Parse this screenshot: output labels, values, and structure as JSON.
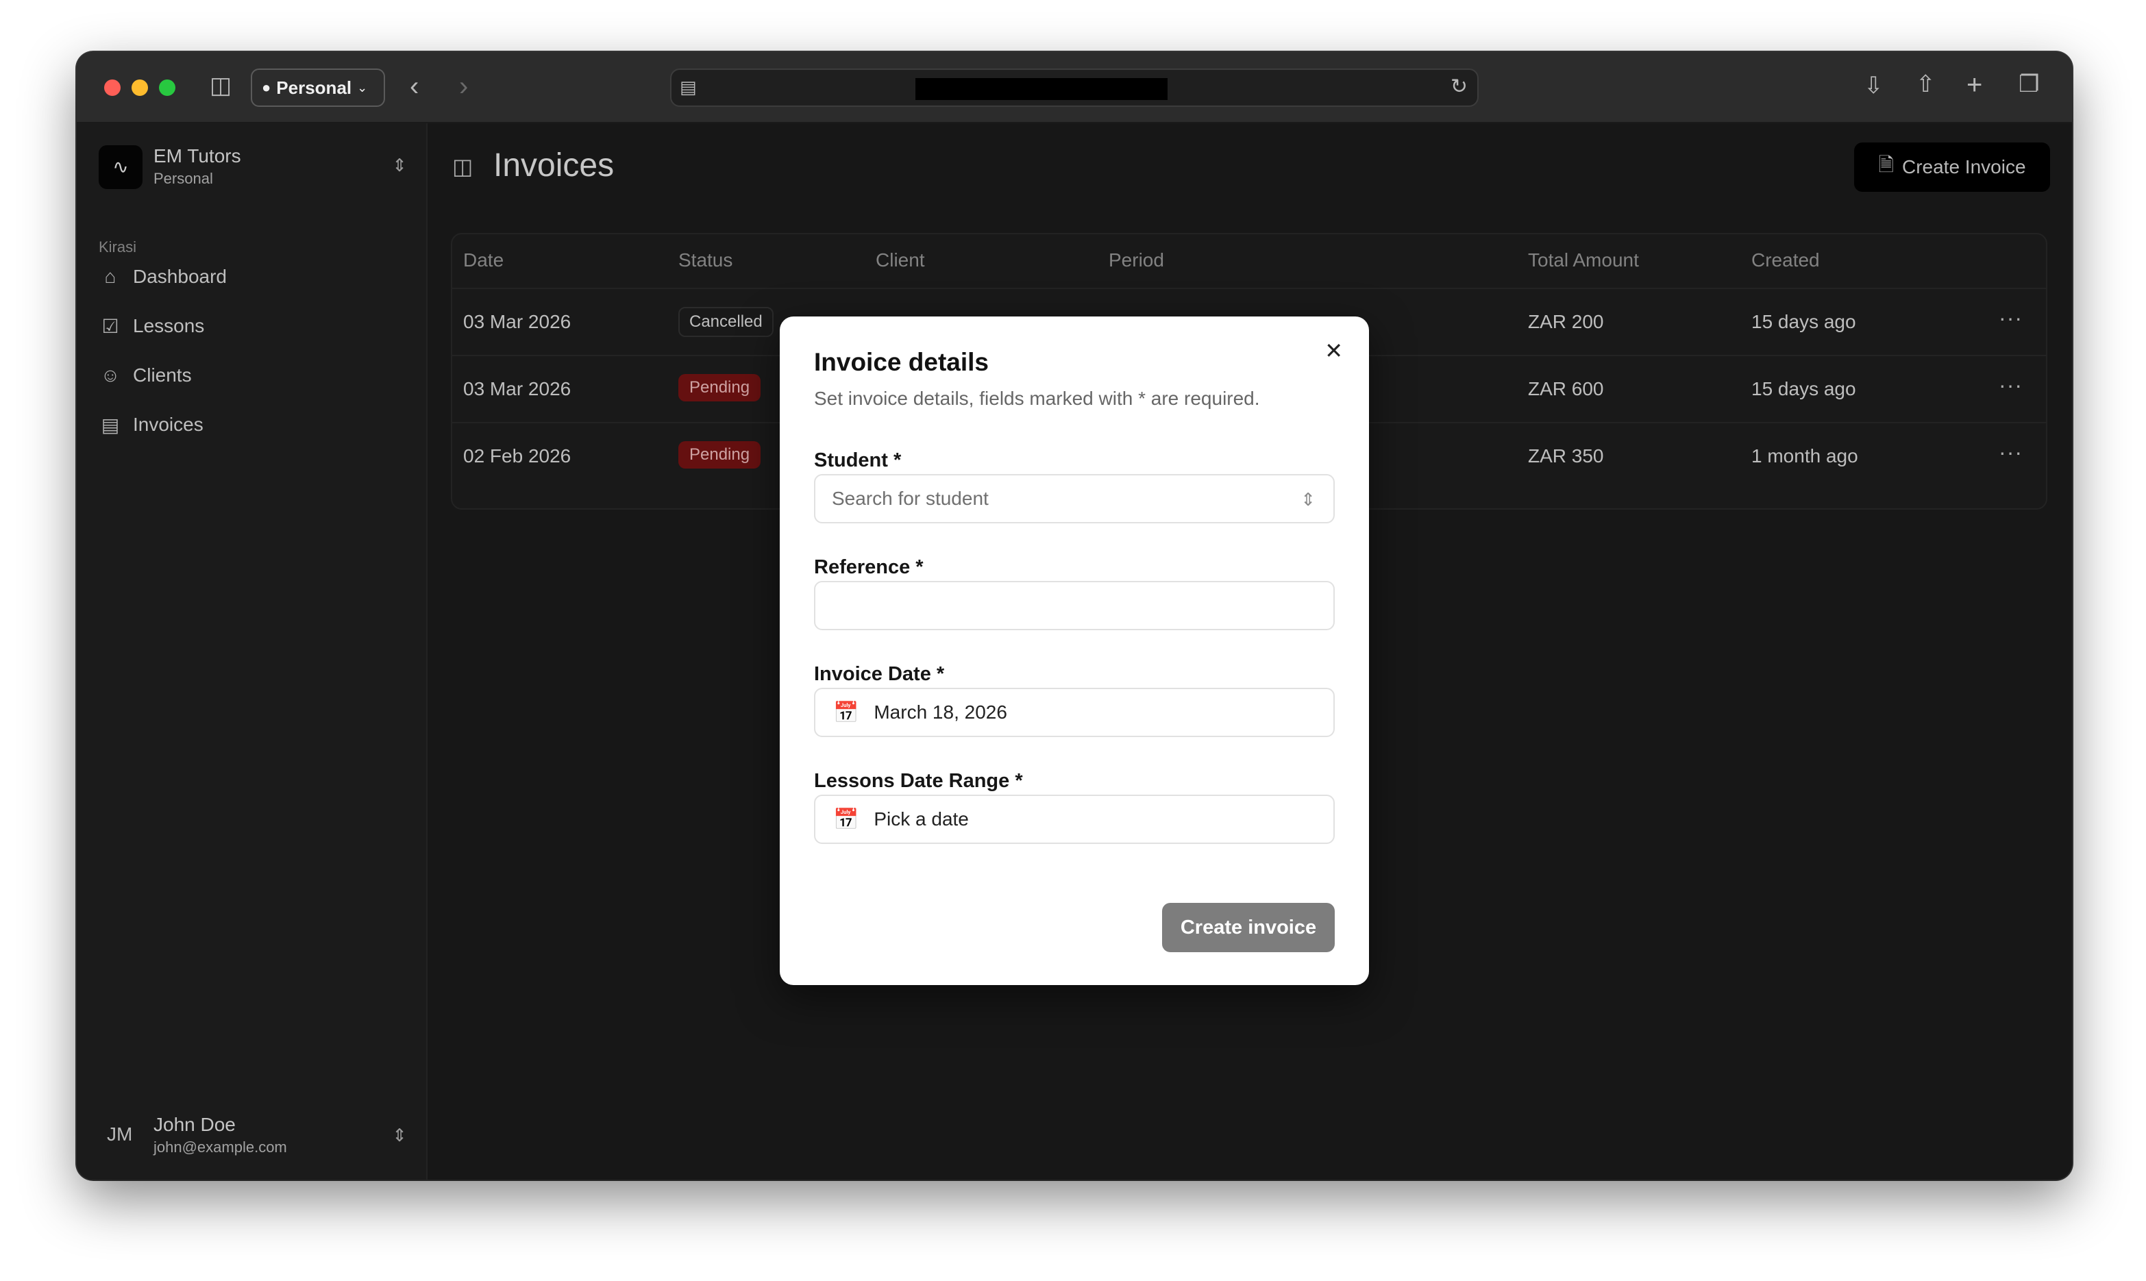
{
  "browser": {
    "profile_label": "Personal"
  },
  "sidebar": {
    "org": {
      "name": "EM Tutors",
      "subtitle": "Personal"
    },
    "group_label": "Kirasi",
    "items": [
      {
        "label": "Dashboard",
        "icon": "home-icon"
      },
      {
        "label": "Lessons",
        "icon": "checklist-icon"
      },
      {
        "label": "Clients",
        "icon": "users-icon"
      },
      {
        "label": "Invoices",
        "icon": "document-icon"
      }
    ],
    "user": {
      "initials": "JM",
      "name": "John Doe",
      "email": "john@example.com"
    }
  },
  "main": {
    "title": "Invoices",
    "create_label": "Create Invoice",
    "columns": [
      "Date",
      "Status",
      "Client",
      "Period",
      "Total Amount",
      "Created"
    ],
    "rows": [
      {
        "date": "03 Mar 2026",
        "status": "Cancelled",
        "amount": "ZAR 200",
        "created": "15 days ago"
      },
      {
        "date": "03 Mar 2026",
        "status": "Pending",
        "amount": "ZAR 600",
        "created": "15 days ago"
      },
      {
        "date": "02 Feb 2026",
        "status": "Pending",
        "amount": "ZAR 350",
        "created": "1 month ago"
      }
    ]
  },
  "modal": {
    "title": "Invoice details",
    "description": "Set invoice details, fields marked with * are required.",
    "student_label": "Student *",
    "student_placeholder": "Search for student",
    "reference_label": "Reference  *",
    "reference_value": "",
    "invoice_date_label": "Invoice Date  *",
    "invoice_date_value": "March 18, 2026",
    "range_label": "Lessons Date Range  *",
    "range_value": "Pick a date",
    "submit_label": "Create invoice"
  },
  "colors": {
    "pending_badge": "#6e1212",
    "submit_disabled": "#7d7d7d"
  }
}
